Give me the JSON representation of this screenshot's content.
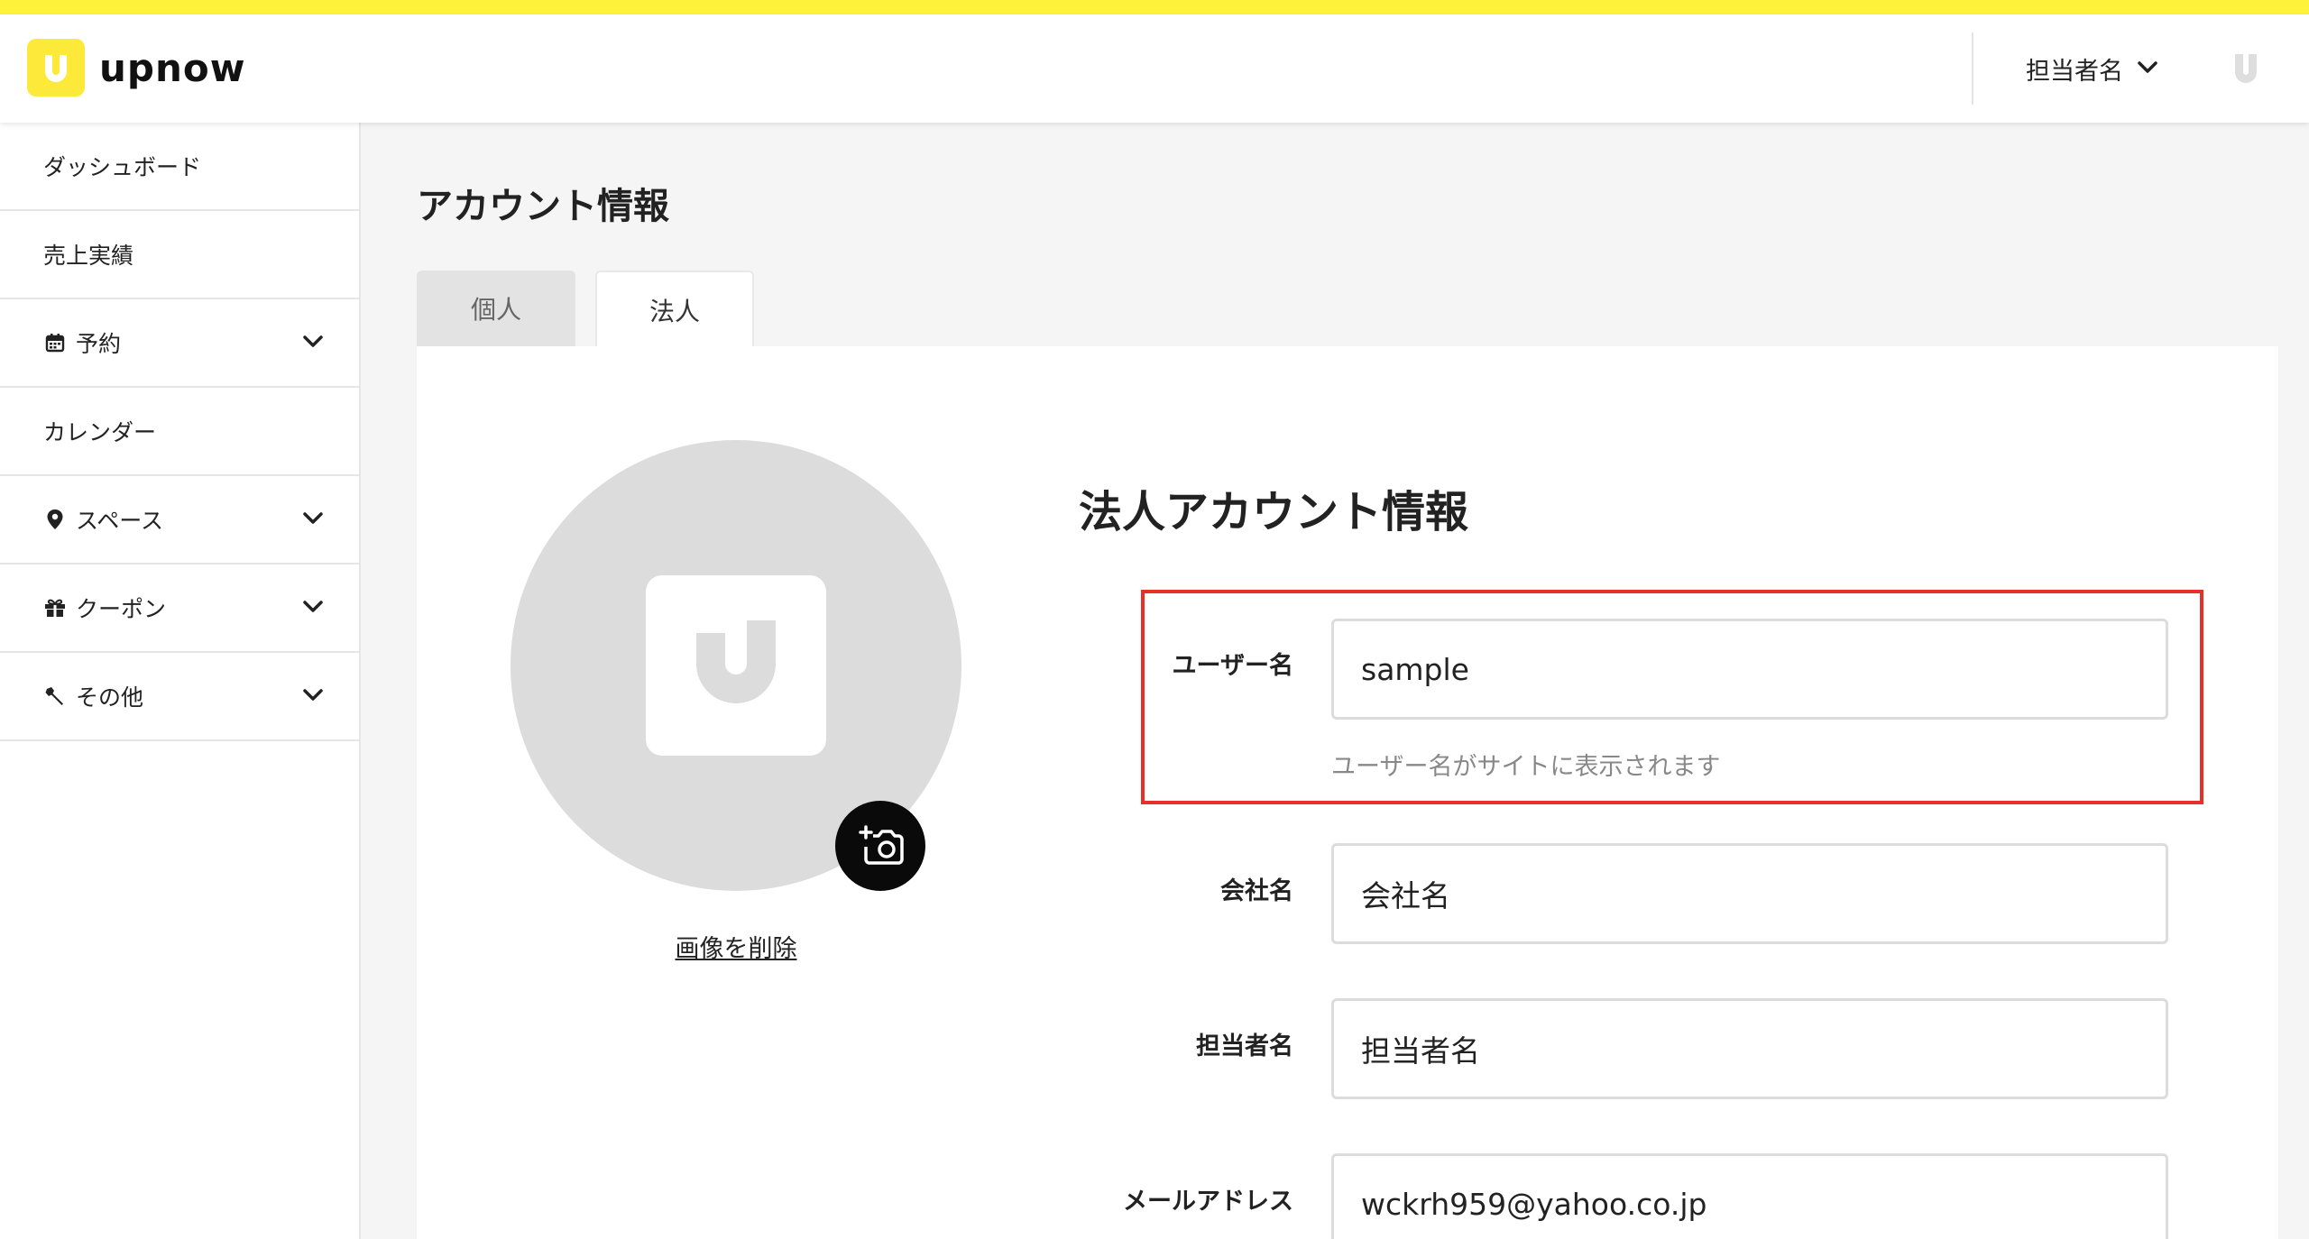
{
  "app": {
    "brand": "upnow",
    "accent_color": "#fde93a",
    "topbar_color": "#fff33a"
  },
  "header": {
    "user_name": "担当者名",
    "avatar_icon": "upnow-logo-icon"
  },
  "sidebar": {
    "items": [
      {
        "label": "ダッシュボード",
        "icon": "",
        "expandable": false
      },
      {
        "label": "売上実績",
        "icon": "",
        "expandable": false
      },
      {
        "label": "予約",
        "icon": "calendar-icon",
        "expandable": true
      },
      {
        "label": "カレンダー",
        "icon": "",
        "expandable": false
      },
      {
        "label": "スペース",
        "icon": "map-pin-icon",
        "expandable": true
      },
      {
        "label": "クーポン",
        "icon": "gift-icon",
        "expandable": true
      },
      {
        "label": "その他",
        "icon": "wrench-icon",
        "expandable": true
      }
    ]
  },
  "main": {
    "page_title": "アカウント情報",
    "tabs": [
      {
        "label": "個人",
        "active": false
      },
      {
        "label": "法人",
        "active": true
      }
    ],
    "avatar": {
      "delete_label": "画像を削除",
      "camera_icon": "camera-add-icon"
    },
    "form": {
      "title": "法人アカウント情報",
      "fields": {
        "username": {
          "label": "ユーザー名",
          "value": "sample",
          "hint": "ユーザー名がサイトに表示されます"
        },
        "company": {
          "label": "会社名",
          "value": "会社名"
        },
        "contact": {
          "label": "担当者名",
          "value": "担当者名"
        },
        "email": {
          "label": "メールアドレス",
          "value": "wckrh959@yahoo.co.jp"
        }
      },
      "highlight_color": "#e8302b"
    }
  }
}
